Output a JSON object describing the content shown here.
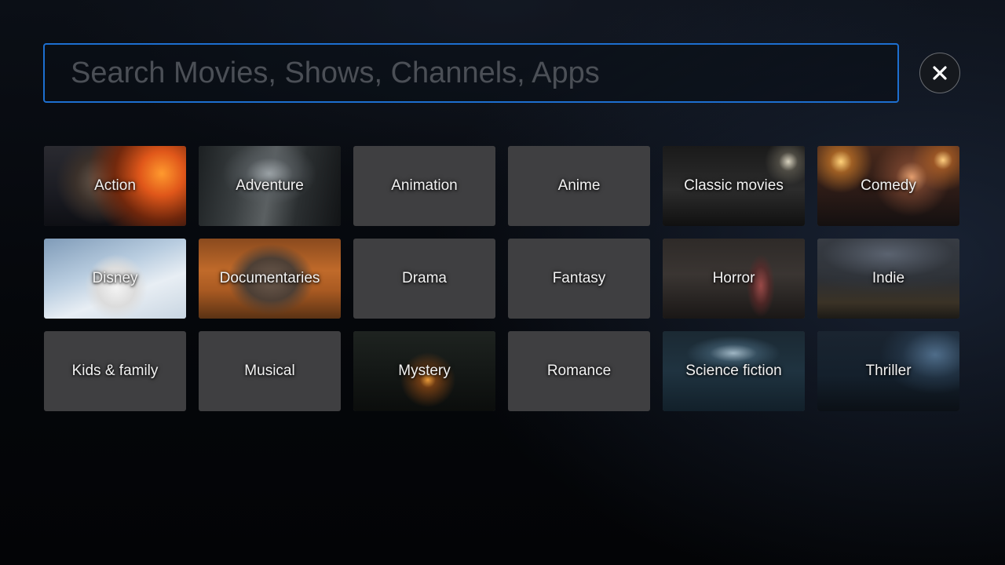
{
  "search": {
    "placeholder": "Search Movies, Shows, Channels, Apps",
    "value": ""
  },
  "close_button": {
    "icon": "close-icon"
  },
  "accent_color": "#1d6fd0",
  "tile_color": "#3f3f41",
  "genres": [
    {
      "label": "Action",
      "has_image": true
    },
    {
      "label": "Adventure",
      "has_image": true
    },
    {
      "label": "Animation",
      "has_image": false
    },
    {
      "label": "Anime",
      "has_image": false
    },
    {
      "label": "Classic movies",
      "has_image": true
    },
    {
      "label": "Comedy",
      "has_image": true
    },
    {
      "label": "Disney",
      "has_image": true
    },
    {
      "label": "Documentaries",
      "has_image": true
    },
    {
      "label": "Drama",
      "has_image": false
    },
    {
      "label": "Fantasy",
      "has_image": false
    },
    {
      "label": "Horror",
      "has_image": true
    },
    {
      "label": "Indie",
      "has_image": true
    },
    {
      "label": "Kids & family",
      "has_image": false
    },
    {
      "label": "Musical",
      "has_image": false
    },
    {
      "label": "Mystery",
      "has_image": true
    },
    {
      "label": "Romance",
      "has_image": false
    },
    {
      "label": "Science fiction",
      "has_image": true
    },
    {
      "label": "Thriller",
      "has_image": true
    }
  ]
}
